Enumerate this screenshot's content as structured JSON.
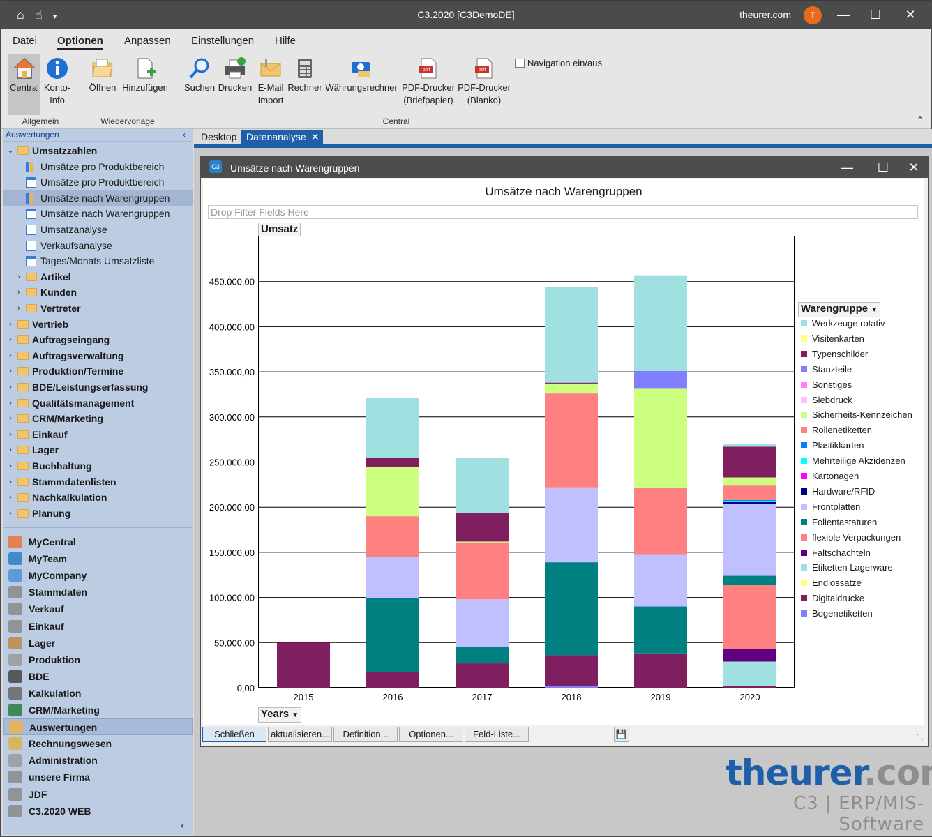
{
  "app": {
    "title": "C3.2020 [C3DemoDE]",
    "user": "theurer.com",
    "avatar": "T"
  },
  "menu": [
    "Datei",
    "Optionen",
    "Anpassen",
    "Einstellungen",
    "Hilfe"
  ],
  "ribbon": {
    "buttons": [
      {
        "label": "Central",
        "label2": ""
      },
      {
        "label": "Konto-",
        "label2": "Info"
      },
      {
        "label": "Öffnen",
        "label2": ""
      },
      {
        "label": "Hinzufügen",
        "label2": ""
      },
      {
        "label": "Suchen",
        "label2": ""
      },
      {
        "label": "Drucken",
        "label2": ""
      },
      {
        "label": "E-Mail",
        "label2": "Import"
      },
      {
        "label": "Rechner",
        "label2": ""
      },
      {
        "label": "Währungsrechner",
        "label2": ""
      },
      {
        "label": "PDF-Drucker",
        "label2": "(Briefpapier)"
      },
      {
        "label": "PDF-Drucker",
        "label2": "(Blanko)"
      }
    ],
    "navigation_toggle": "Navigation ein/aus",
    "groups": [
      "Allgemein",
      "Wiedervorlage",
      "Central"
    ]
  },
  "sidebar": {
    "header": "Auswertungen",
    "tree": [
      {
        "label": "Umsatzzahlen",
        "level": 0,
        "expanded": true
      },
      {
        "label": "Umsätze pro Produktbereich",
        "level": 1,
        "icon": "bar-chart-icon"
      },
      {
        "label": "Umsätze pro Produktbereich",
        "level": 1,
        "icon": "table-icon"
      },
      {
        "label": "Umsätze nach Warengruppen",
        "level": 1,
        "icon": "bar-chart-icon",
        "selected": true
      },
      {
        "label": "Umsätze nach Warengruppen",
        "level": 1,
        "icon": "table-icon"
      },
      {
        "label": "Umsatzanalyse",
        "level": 1,
        "icon": "analysis-icon"
      },
      {
        "label": "Verkaufsanalyse",
        "level": 1,
        "icon": "analysis-icon"
      },
      {
        "label": "Tages/Monats Umsatzliste",
        "level": 1,
        "icon": "table-icon"
      },
      {
        "label": "Artikel",
        "level": 1,
        "folder": true
      },
      {
        "label": "Kunden",
        "level": 1,
        "folder": true
      },
      {
        "label": "Vertreter",
        "level": 1,
        "folder": true
      },
      {
        "label": "Vertrieb",
        "level": 0
      },
      {
        "label": "Auftragseingang",
        "level": 0
      },
      {
        "label": "Auftragsverwaltung",
        "level": 0
      },
      {
        "label": "Produktion/Termine",
        "level": 0
      },
      {
        "label": "BDE/Leistungserfassung",
        "level": 0
      },
      {
        "label": "Qualitätsmanagement",
        "level": 0
      },
      {
        "label": "CRM/Marketing",
        "level": 0
      },
      {
        "label": "Einkauf",
        "level": 0
      },
      {
        "label": "Lager",
        "level": 0
      },
      {
        "label": "Buchhaltung",
        "level": 0
      },
      {
        "label": "Stammdatenlisten",
        "level": 0
      },
      {
        "label": "Nachkalkulation",
        "level": 0
      },
      {
        "label": "Planung",
        "level": 0
      }
    ],
    "nav": [
      {
        "label": "MyCentral",
        "icon": "home-icon"
      },
      {
        "label": "MyTeam",
        "icon": "team-icon"
      },
      {
        "label": "MyCompany",
        "icon": "globe-icon"
      },
      {
        "label": "Stammdaten",
        "icon": "printer-icon"
      },
      {
        "label": "Verkauf",
        "icon": "printer-icon"
      },
      {
        "label": "Einkauf",
        "icon": "printer-icon"
      },
      {
        "label": "Lager",
        "icon": "box-icon"
      },
      {
        "label": "Produktion",
        "icon": "tools-icon"
      },
      {
        "label": "BDE",
        "icon": "barcode-icon"
      },
      {
        "label": "Kalkulation",
        "icon": "calculator-icon"
      },
      {
        "label": "CRM/Marketing",
        "icon": "handshake-icon"
      },
      {
        "label": "Auswertungen",
        "icon": "bar-chart-icon",
        "selected": true
      },
      {
        "label": "Rechnungswesen",
        "icon": "coins-icon"
      },
      {
        "label": "Administration",
        "icon": "gear-icon"
      },
      {
        "label": "unsere Firma",
        "icon": "printer-icon"
      },
      {
        "label": "JDF",
        "icon": "printer-icon"
      },
      {
        "label": "C3.2020 WEB",
        "icon": "printer-icon"
      }
    ]
  },
  "tabs": [
    "Desktop",
    "Datenanalyse"
  ],
  "child_window": {
    "title": "Umsätze nach Warengruppen",
    "logo": "C3"
  },
  "pivot": {
    "filter_placeholder": "Drop Filter Fields Here",
    "data_field": "Umsatz",
    "column_field": "Years",
    "legend_field": "Warengruppe",
    "buttons": [
      "Schließen",
      "aktualisieren...",
      "Definition...",
      "Optionen...",
      "Feld-Liste..."
    ]
  },
  "chart_data": {
    "type": "bar",
    "stacked": true,
    "title": "Umsätze nach Warengruppen",
    "ylim": [
      0,
      500000
    ],
    "yticks": [
      0,
      50000,
      100000,
      150000,
      200000,
      250000,
      300000,
      350000,
      400000,
      450000
    ],
    "ytick_labels": [
      "0,00",
      "50.000,00",
      "100.000,00",
      "150.000,00",
      "200.000,00",
      "250.000,00",
      "300.000,00",
      "350.000,00",
      "400.000,00",
      "450.000,00"
    ],
    "categories": [
      "2015",
      "2016",
      "2017",
      "2018",
      "2019",
      "2020"
    ],
    "legend_position": "right",
    "series": [
      {
        "name": "Bogenetiketten",
        "color": "#8080ff",
        "values": [
          0,
          0,
          0,
          1500,
          0,
          0
        ]
      },
      {
        "name": "Digitaldrucke",
        "color": "#7f1f5f",
        "values": [
          50000,
          17000,
          27000,
          34500,
          38000,
          2000
        ]
      },
      {
        "name": "Endlossätze",
        "color": "#ffff80",
        "values": [
          0,
          0,
          0,
          0,
          0,
          0
        ]
      },
      {
        "name": "Etiketten Lagerware",
        "color": "#a0e0e0",
        "values": [
          0,
          0,
          0,
          0,
          0,
          27000
        ]
      },
      {
        "name": "Faltschachteln",
        "color": "#600080",
        "values": [
          0,
          0,
          0,
          0,
          0,
          14000
        ]
      },
      {
        "name": "flexible Verpackungen",
        "color": "#ff8080",
        "values": [
          0,
          0,
          0,
          0,
          0,
          71000
        ]
      },
      {
        "name": "Folientastaturen",
        "color": "#008080",
        "values": [
          0,
          82000,
          18000,
          103000,
          52000,
          10000
        ]
      },
      {
        "name": "Frontplatten",
        "color": "#c0c0ff",
        "values": [
          0,
          46000,
          53000,
          83000,
          58000,
          80000
        ]
      },
      {
        "name": "Hardware/RFID",
        "color": "#000080",
        "values": [
          0,
          0,
          0,
          0,
          0,
          2000
        ]
      },
      {
        "name": "Kartonagen",
        "color": "#ff00ff",
        "values": [
          0,
          0,
          0,
          0,
          0,
          0
        ]
      },
      {
        "name": "Mehrteilige Akzidenzen",
        "color": "#00ffff",
        "values": [
          0,
          0,
          0,
          0,
          0,
          1000
        ]
      },
      {
        "name": "Plastikkarten",
        "color": "#0080ff",
        "values": [
          0,
          0,
          0,
          0,
          0,
          1000
        ]
      },
      {
        "name": "Rollenetiketten",
        "color": "#ff8080",
        "values": [
          0,
          45000,
          63000,
          104000,
          73000,
          16000
        ]
      },
      {
        "name": "Sicherheits-Kennzeichen",
        "color": "#ccff80",
        "values": [
          0,
          55000,
          1000,
          11000,
          111000,
          9000
        ]
      },
      {
        "name": "Siebdruck",
        "color": "#ffc0ff",
        "values": [
          0,
          0,
          0,
          0,
          0,
          0
        ]
      },
      {
        "name": "Sonstiges",
        "color": "#ff80ff",
        "values": [
          0,
          0,
          0,
          0,
          0,
          0
        ]
      },
      {
        "name": "Stanzteile",
        "color": "#8080ff",
        "values": [
          0,
          0,
          0,
          0,
          19000,
          0
        ]
      },
      {
        "name": "Typenschilder",
        "color": "#7f1f5f",
        "values": [
          0,
          9500,
          32000,
          1000,
          0,
          34000
        ]
      },
      {
        "name": "Visitenkarten",
        "color": "#ffff80",
        "values": [
          0,
          0,
          0,
          0,
          0,
          0
        ]
      },
      {
        "name": "Werkzeuge rotativ",
        "color": "#a0e0e0",
        "values": [
          0,
          67000,
          61000,
          106000,
          106000,
          3000
        ]
      }
    ]
  },
  "brand": {
    "main": "theurer",
    "ext": ".com",
    "sub": "C3 | ERP/MIS-Software"
  }
}
